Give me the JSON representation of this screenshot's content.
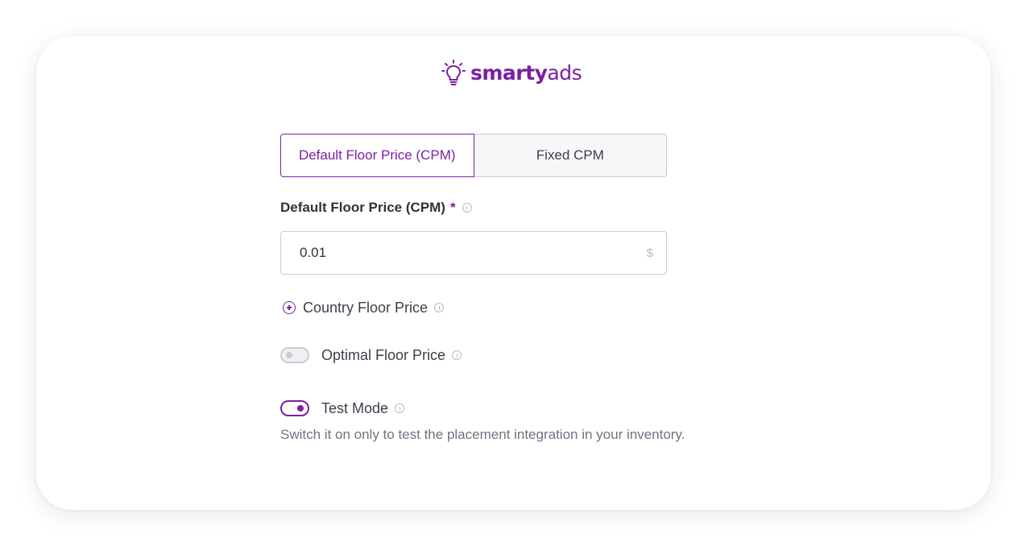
{
  "brand": {
    "name_bold": "smarty",
    "name_light": "ads",
    "color": "#7b1fa2",
    "icon": "lightbulb-icon"
  },
  "tabs": [
    {
      "label": "Default Floor Price (CPM)",
      "active": true
    },
    {
      "label": "Fixed CPM",
      "active": false
    }
  ],
  "floor_price": {
    "label": "Default Floor Price (CPM)",
    "required_mark": "*",
    "value": "0.01",
    "currency": "$",
    "info_icon": "info-icon"
  },
  "country_floor": {
    "label": "Country Floor Price",
    "icon": "add-circle-icon"
  },
  "optimal_floor": {
    "label": "Optimal Floor Price",
    "enabled": false
  },
  "test_mode": {
    "label": "Test Mode",
    "enabled": true,
    "helper": "Switch it on only to test the placement integration in your inventory."
  },
  "colors": {
    "accent": "#7b1fa2",
    "border": "#c9ccd6",
    "text": "#3b3f4a",
    "muted": "#6e7380"
  }
}
